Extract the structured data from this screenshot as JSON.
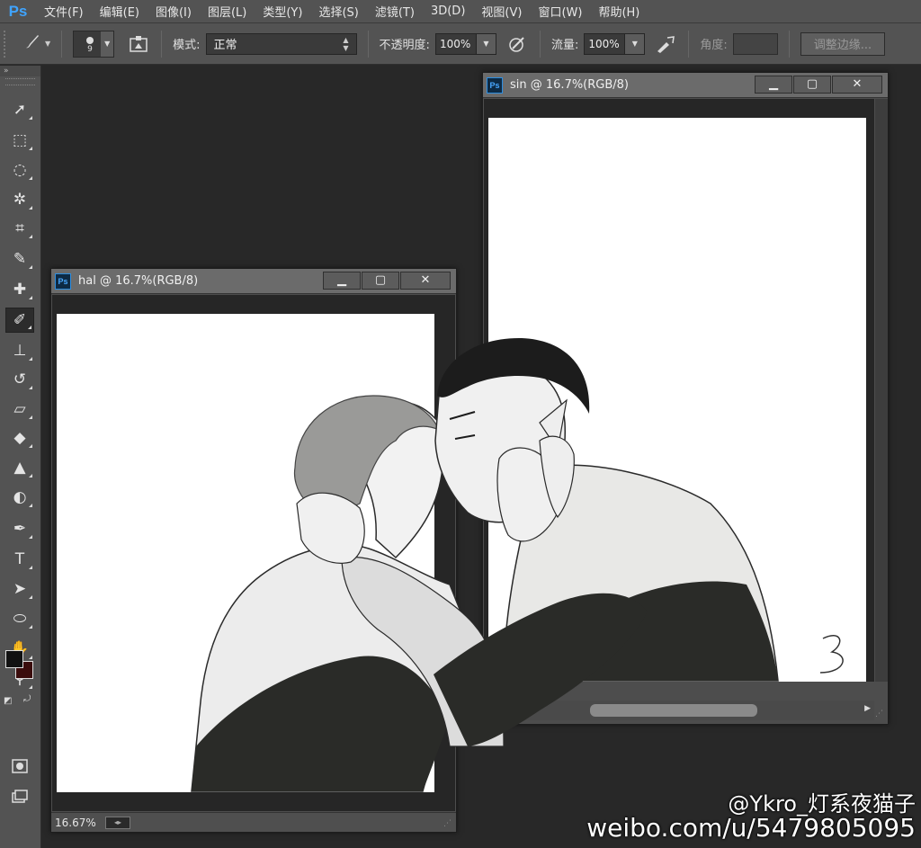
{
  "app": {
    "logo": "Ps",
    "accent": "#3fa4ff"
  },
  "menu": [
    "文件(F)",
    "编辑(E)",
    "图像(I)",
    "图层(L)",
    "类型(Y)",
    "选择(S)",
    "滤镜(T)",
    "3D(D)",
    "视图(V)",
    "窗口(W)",
    "帮助(H)"
  ],
  "options": {
    "tool_icon": "brush-icon",
    "brush_size": "9",
    "mode_label": "模式:",
    "mode_value": "正常",
    "opacity_label": "不透明度:",
    "opacity_value": "100%",
    "flow_label": "流量:",
    "flow_value": "100%",
    "angle_label": "角度:",
    "refine_button": "调整边缘..."
  },
  "tools": [
    "move-icon",
    "marquee-icon",
    "lasso-icon",
    "magic-wand-icon",
    "crop-icon",
    "eyedropper-icon",
    "healing-brush-icon",
    "brush-icon",
    "clone-stamp-icon",
    "history-brush-icon",
    "eraser-icon",
    "paint-bucket-icon",
    "blur-icon",
    "dodge-icon",
    "pen-icon",
    "type-icon",
    "path-selection-icon",
    "ellipse-icon",
    "hand-icon",
    "zoom-icon"
  ],
  "colors": {
    "foreground": "#111111",
    "background": "#3a0c0c"
  },
  "documents": {
    "sin": {
      "title": "sin @ 16.7%(RGB/8)"
    },
    "hal": {
      "title": "hal @ 16.7%(RGB/8)",
      "zoom": "16.67%"
    }
  },
  "window_controls": {
    "minimize": "▁",
    "restore": "▢",
    "close": "✕"
  },
  "watermark": {
    "line1": "@Ykro_灯系夜猫子",
    "line2": "weibo.com/u/5479805095"
  }
}
